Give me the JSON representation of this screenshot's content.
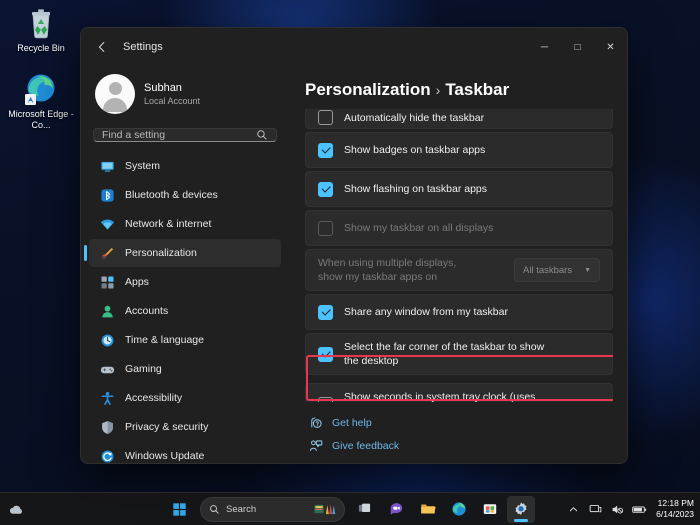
{
  "desktop": {
    "icons": [
      {
        "name": "recycle-bin",
        "label": "Recycle Bin"
      },
      {
        "name": "microsoft-edge",
        "label": "Microsoft Edge - Co..."
      }
    ]
  },
  "window": {
    "title": "Settings",
    "back_icon": "back-arrow-icon",
    "controls": {
      "minimize": "─",
      "maximize": "□",
      "close": "✕"
    }
  },
  "sidebar": {
    "profile": {
      "name": "Subhan",
      "subtitle": "Local Account",
      "avatar_icon": "user-avatar-icon"
    },
    "search": {
      "placeholder": "Find a setting",
      "icon": "search-icon"
    },
    "items": [
      {
        "label": "System",
        "icon": "system-icon",
        "active": false
      },
      {
        "label": "Bluetooth & devices",
        "icon": "bluetooth-icon",
        "active": false
      },
      {
        "label": "Network & internet",
        "icon": "network-icon",
        "active": false
      },
      {
        "label": "Personalization",
        "icon": "personalization-brush-icon",
        "active": true
      },
      {
        "label": "Apps",
        "icon": "apps-icon",
        "active": false
      },
      {
        "label": "Accounts",
        "icon": "accounts-icon",
        "active": false
      },
      {
        "label": "Time & language",
        "icon": "time-language-icon",
        "active": false
      },
      {
        "label": "Gaming",
        "icon": "gaming-controller-icon",
        "active": false
      },
      {
        "label": "Accessibility",
        "icon": "accessibility-icon",
        "active": false
      },
      {
        "label": "Privacy & security",
        "icon": "shield-icon",
        "active": false
      },
      {
        "label": "Windows Update",
        "icon": "windows-update-icon",
        "active": false
      }
    ]
  },
  "main": {
    "breadcrumb": {
      "parent": "Personalization",
      "separator": "›",
      "current": "Taskbar"
    },
    "settings": [
      {
        "label": "Automatically hide the taskbar",
        "checked": false,
        "disabled": false,
        "clipped": true
      },
      {
        "label": "Show badges on taskbar apps",
        "checked": true,
        "disabled": false
      },
      {
        "label": "Show flashing on taskbar apps",
        "checked": true,
        "disabled": false
      },
      {
        "label": "Show my taskbar on all displays",
        "checked": false,
        "disabled": true
      },
      {
        "label": "When using multiple displays, show my taskbar apps on",
        "disabled": true,
        "dropdown": {
          "value": "All taskbars",
          "chevron": "chevron-down-icon"
        }
      },
      {
        "label": "Share any window from my taskbar",
        "checked": true,
        "disabled": false
      },
      {
        "label": "Select the far corner of the taskbar to show the desktop",
        "checked": true,
        "disabled": false
      },
      {
        "label": "Show seconds in system tray clock (uses more power)",
        "checked": false,
        "disabled": false,
        "highlighted": true
      }
    ],
    "links": [
      {
        "label": "Get help",
        "icon": "help-icon"
      },
      {
        "label": "Give feedback",
        "icon": "feedback-icon"
      }
    ]
  },
  "taskbar": {
    "weather_icon": "weather-cloud-icon",
    "start_icon": "windows-start-icon",
    "search": {
      "label": "Search",
      "icon": "search-icon"
    },
    "apps": [
      {
        "name": "task-view-icon",
        "active": false
      },
      {
        "name": "chat-icon",
        "active": false
      },
      {
        "name": "file-explorer-icon",
        "active": false
      },
      {
        "name": "microsoft-edge-icon",
        "active": false
      },
      {
        "name": "microsoft-store-icon",
        "active": false
      },
      {
        "name": "settings-gear-icon",
        "active": true
      }
    ],
    "tray": [
      {
        "name": "chevron-up-icon"
      },
      {
        "name": "display-icon"
      },
      {
        "name": "speaker-muted-icon"
      },
      {
        "name": "battery-icon"
      }
    ],
    "clock": {
      "time": "12:18 PM",
      "date": "6/14/2023"
    }
  },
  "colors": {
    "accent": "#4cc2ff",
    "highlight": "#e8384f",
    "window_bg": "#202020",
    "card_bg": "#2b2b2b",
    "link": "#6fb8e8"
  }
}
